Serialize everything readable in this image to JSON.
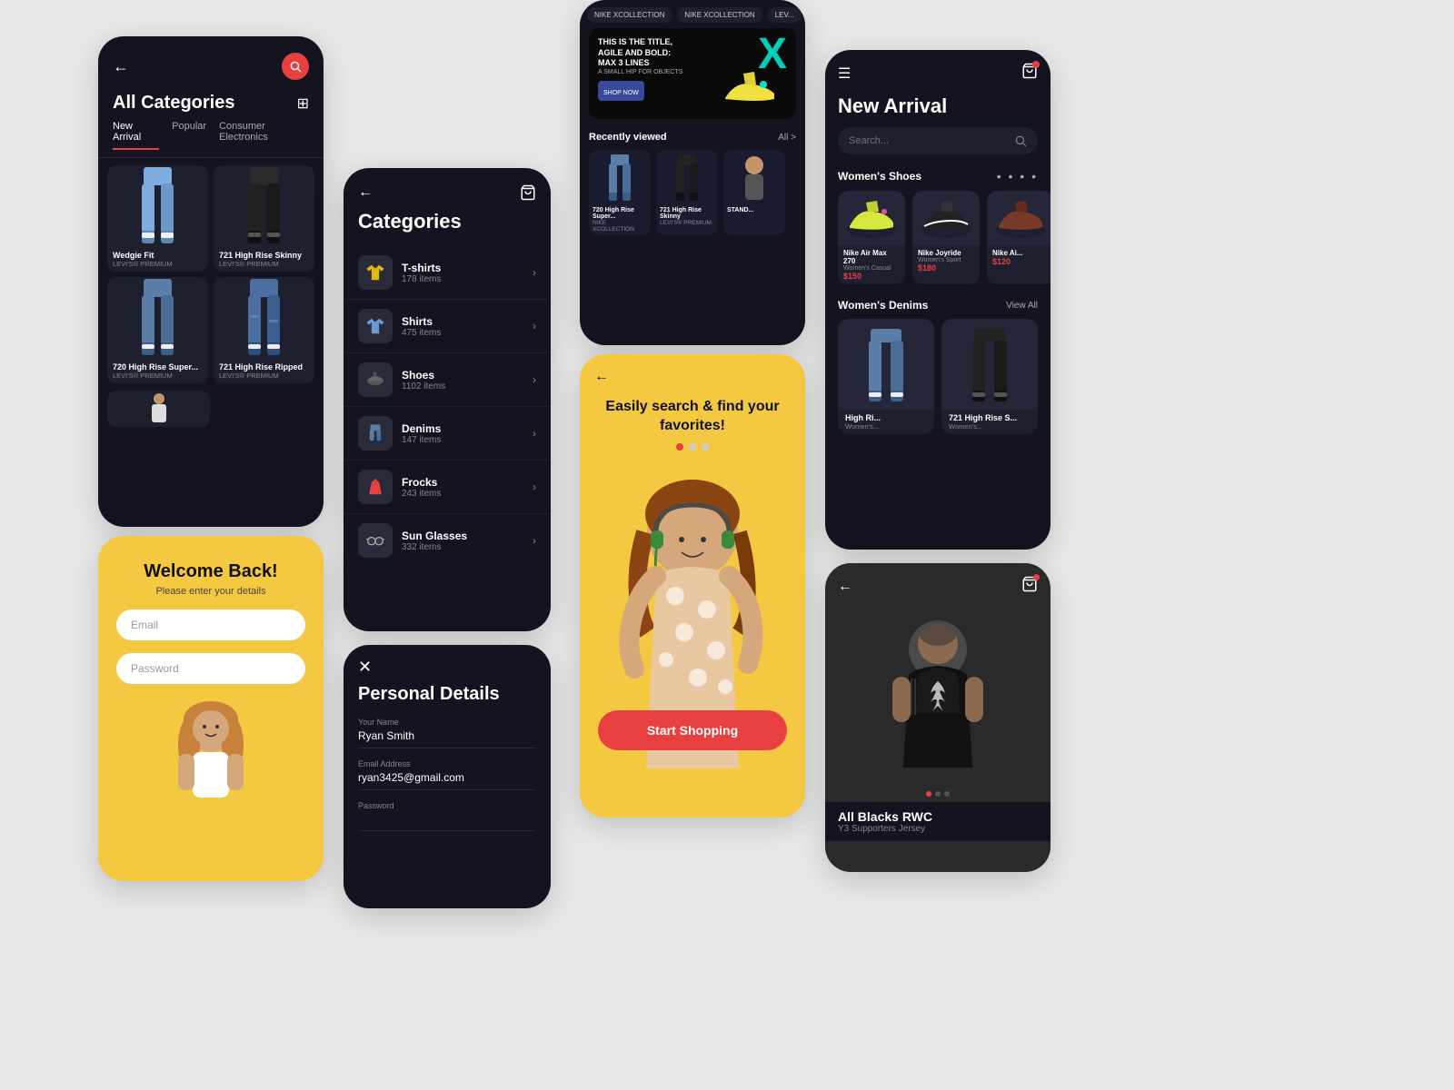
{
  "allcat": {
    "back_icon": "←",
    "search_icon": "🔍",
    "title": "All Categories",
    "tabs": [
      "New Arrival",
      "Popular",
      "Consumer Electronics"
    ],
    "products": [
      {
        "name": "Wedgie Fit",
        "brand": "LEVI'S® PREMIUM",
        "color": "light"
      },
      {
        "name": "721 High Rise Skinny",
        "brand": "LEVI'S® PREMIUM",
        "color": "dark"
      },
      {
        "name": "720 High Rise Super...",
        "brand": "LEVI'S® PREMIUM",
        "color": "medium"
      },
      {
        "name": "721 High Rise Ripped",
        "brand": "LEVI'S® PREMIUM",
        "color": "ripped"
      },
      {
        "name": "...",
        "brand": "...",
        "color": "dark"
      }
    ]
  },
  "welcome": {
    "title": "Welcome Back!",
    "subtitle": "Please enter your details",
    "email_placeholder": "Email",
    "password_placeholder": "Password"
  },
  "catlist": {
    "back_icon": "←",
    "cart_icon": "🛒",
    "title": "Categories",
    "items": [
      {
        "name": "T-shirts",
        "count": "178 items",
        "icon": "👕"
      },
      {
        "name": "Shirts",
        "count": "475 items",
        "icon": "👔"
      },
      {
        "name": "Shoes",
        "count": "1102 items",
        "icon": "👟"
      },
      {
        "name": "Denims",
        "count": "147 items",
        "icon": "👖"
      },
      {
        "name": "Frocks",
        "count": "243 items",
        "icon": "👗"
      },
      {
        "name": "Sun Glasses",
        "count": "332 items",
        "icon": "🕶️"
      }
    ]
  },
  "personal": {
    "close_icon": "✕",
    "title": "Personal Details",
    "fields": [
      {
        "label": "Your Name",
        "value": "Ryan Smith"
      },
      {
        "label": "Email Address",
        "value": "ryan3425@gmail.com"
      },
      {
        "label": "Password",
        "value": ""
      }
    ]
  },
  "nike": {
    "product_tabs": [
      "NIKE XCOLLECTION",
      "NIKE XCOLLECTION",
      "LEV..."
    ],
    "hero": {
      "line1": "THIS IS THE TITLE,",
      "line2": "AGILE AND BOLD:",
      "line3": "MAX 3 LINES",
      "sub": "A SMALL HIP FOR OBJECTS",
      "x_letter": "X"
    },
    "recently_label": "Recently viewed",
    "all_link": "All >",
    "recent_items": [
      {
        "name": "720 High Rise Super...",
        "brand": "NIKE XCOLLECTION"
      },
      {
        "name": "721 High Rise Skinny",
        "brand": "LEVI'S® PREMIUM"
      },
      {
        "name": "STAND...",
        "brand": ""
      }
    ]
  },
  "search_screen": {
    "back_icon": "←",
    "tagline": "Easily search & find your favorites!",
    "start_btn": "Start Shopping",
    "dots": [
      "active",
      "inactive",
      "inactive"
    ]
  },
  "arrival": {
    "menu_icon": "☰",
    "cart_icon": "🛒",
    "title": "New Arrival",
    "search_placeholder": "Search...",
    "sections": {
      "shoes": {
        "label": "Women's Shoes",
        "items": [
          {
            "name": "Nike Air Max 270",
            "sub": "Women's Casual",
            "price": "$150"
          },
          {
            "name": "Nike Joyride",
            "sub": "Women's Sport",
            "price": "$180"
          },
          {
            "name": "Nike Ai...",
            "sub": "",
            "price": "$120"
          }
        ]
      },
      "denims": {
        "label": "Women's Denims",
        "view_all": "View All",
        "items": [
          {
            "name": "High Ri...",
            "sub": "Women's..."
          },
          {
            "name": "721 High Rise S...",
            "sub": "Women's..."
          }
        ]
      }
    }
  },
  "allblacks": {
    "back_icon": "←",
    "cart_icon": "🛒",
    "name": "All Blacks RWC",
    "sub": "Y3 Supporters Jersey",
    "dots": [
      true,
      false,
      false
    ]
  }
}
